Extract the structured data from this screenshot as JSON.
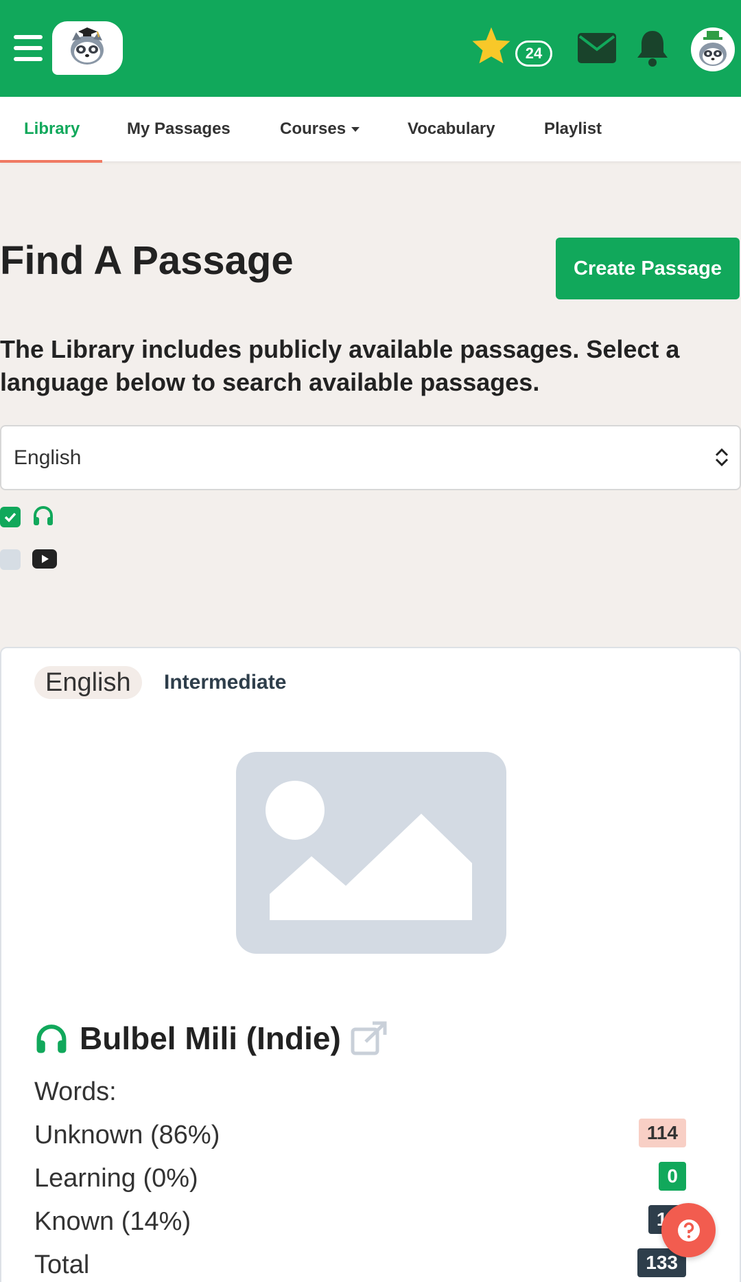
{
  "header": {
    "menu_icon": "hamburger-icon",
    "logo_icon": "raccoon-graduate-logo",
    "star_icon": "star-icon",
    "star_count": "24",
    "mail_icon": "envelope-icon",
    "bell_icon": "bell-icon",
    "avatar_icon": "raccoon-avatar"
  },
  "nav": {
    "tabs": [
      {
        "label": "Library",
        "active": true
      },
      {
        "label": "My Passages"
      },
      {
        "label": "Courses"
      },
      {
        "label": "Vocabulary"
      },
      {
        "label": "Playlist"
      }
    ]
  },
  "main": {
    "title": "Find A Passage",
    "create_button": "Create Passage",
    "intro": "The Library includes publicly available passages. Select a language below to search available passages.",
    "language_select": "English",
    "filters": [
      {
        "icon": "headphones-icon",
        "checked": true
      },
      {
        "icon": "youtube-icon",
        "checked": false
      }
    ]
  },
  "card": {
    "language": "English",
    "level": "Intermediate",
    "image_icon": "image-placeholder-icon",
    "audio_icon": "headphones-icon",
    "title": "Bulbel Mili (Indie)",
    "link_icon": "external-link-icon",
    "words_label": "Words:",
    "stats": [
      {
        "label": "Unknown (86%)",
        "value": "114"
      },
      {
        "label": "Learning (0%)",
        "value": "0"
      },
      {
        "label": "Known (14%)",
        "value": "19"
      },
      {
        "label": "Total",
        "value": "133"
      }
    ]
  },
  "help_icon": "question-circle-icon",
  "colors": {
    "brand_green": "#11a85b",
    "accent_orange": "#f07a63",
    "help_red": "#f25c4f",
    "page_bg": "#f3efec"
  }
}
